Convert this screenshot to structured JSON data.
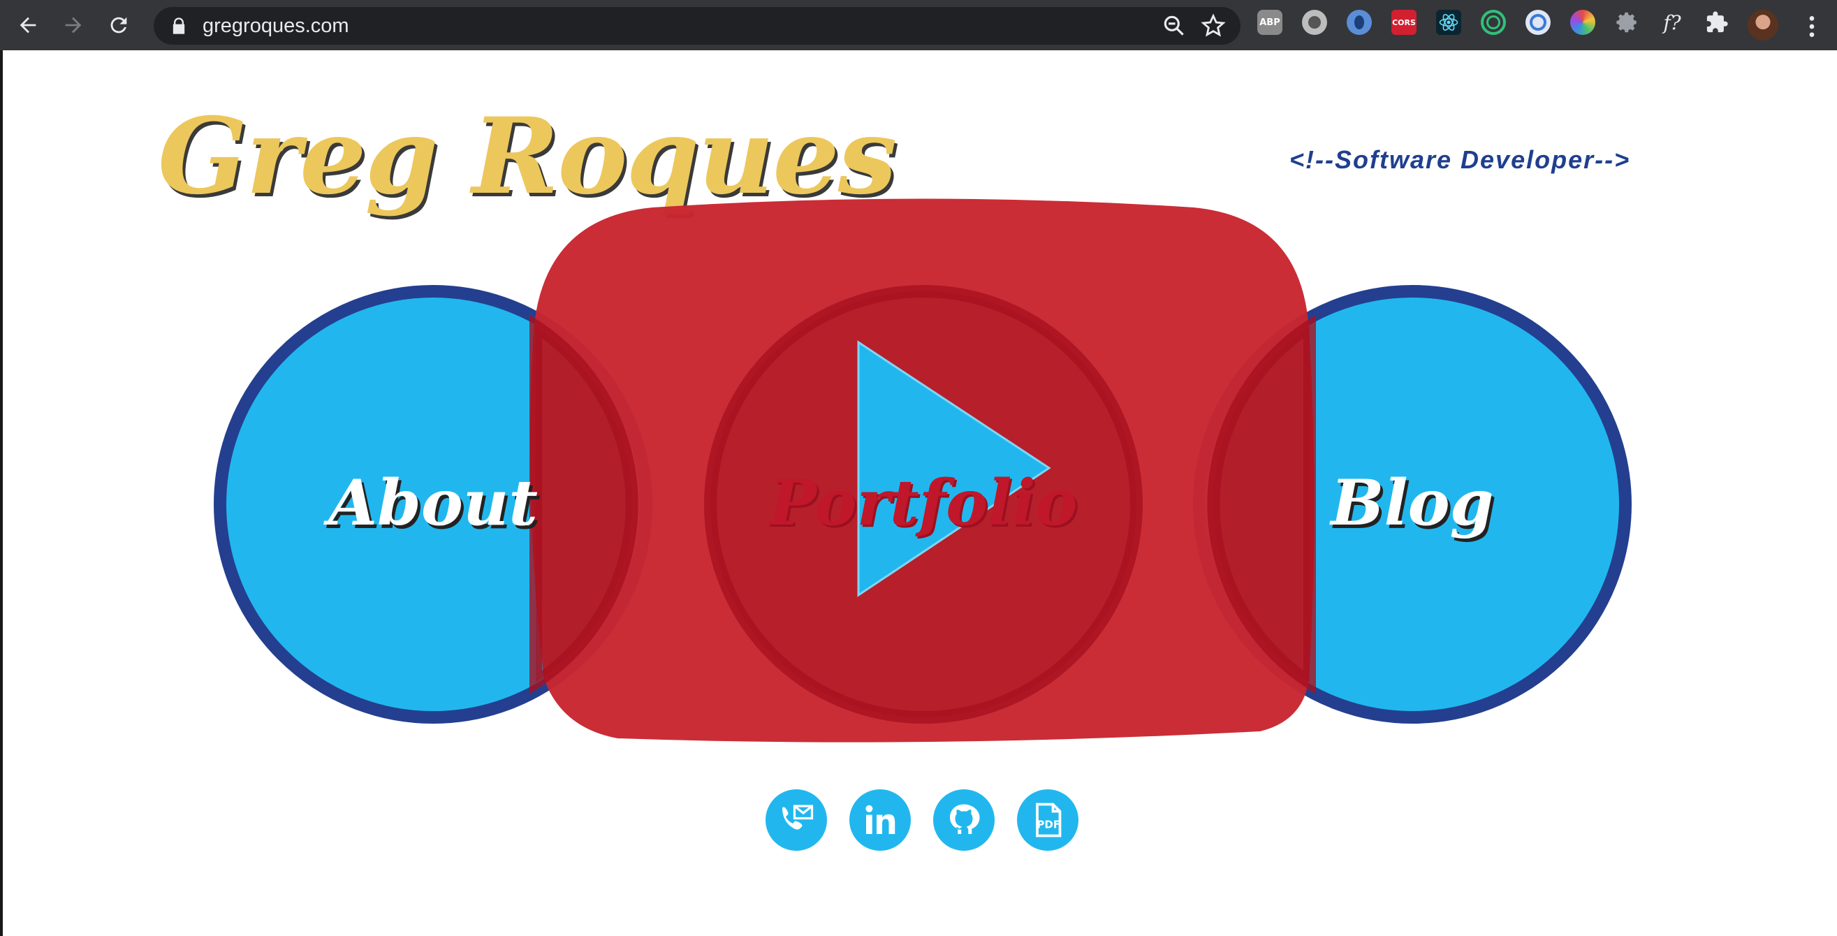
{
  "browser": {
    "url": "gregroques.com",
    "extensions": [
      {
        "name": "adblock-icon",
        "label": "ABP",
        "color": "#8a8a8a"
      },
      {
        "name": "circle-extension-icon",
        "label": "",
        "color": "#bdbdbd"
      },
      {
        "name": "drop-extension-icon",
        "label": "",
        "color": "#5a8fd8"
      },
      {
        "name": "cors-extension-icon",
        "label": "CORS",
        "color": "#d22030"
      },
      {
        "name": "react-devtools-icon",
        "label": "",
        "color": "#0b2530"
      },
      {
        "name": "target-extension-icon",
        "label": "",
        "color": "#2fc27a"
      },
      {
        "name": "cursor-extension-icon",
        "label": "",
        "color": "#3c78d8"
      },
      {
        "name": "color-wheel-extension-icon",
        "label": "",
        "color": "#e34b8c"
      },
      {
        "name": "gear-extension-icon",
        "label": "",
        "color": "#9aa0a6"
      },
      {
        "name": "font-extension-icon",
        "label": "f?",
        "color": "#35363a"
      },
      {
        "name": "puzzle-icon",
        "label": "",
        "color": "#35363a"
      }
    ]
  },
  "site": {
    "title": "Greg Roques",
    "tagline": "<!--Software Developer-->",
    "nav": {
      "about": "About",
      "portfolio": "Portfolio",
      "blog": "Blog"
    },
    "social": [
      {
        "name": "phone-email-icon",
        "label": "Contact"
      },
      {
        "name": "linkedin-icon",
        "label": "LinkedIn"
      },
      {
        "name": "github-icon",
        "label": "GitHub"
      },
      {
        "name": "pdf-icon",
        "label": "PDF"
      }
    ]
  },
  "colors": {
    "chrome_bg": "#35363a",
    "title_gold": "#ecc75b",
    "tagline_blue": "#1f3f8f",
    "circle_blue": "#21b7ee",
    "circle_border": "#243f8f",
    "youtube_red": "#c8262f"
  }
}
